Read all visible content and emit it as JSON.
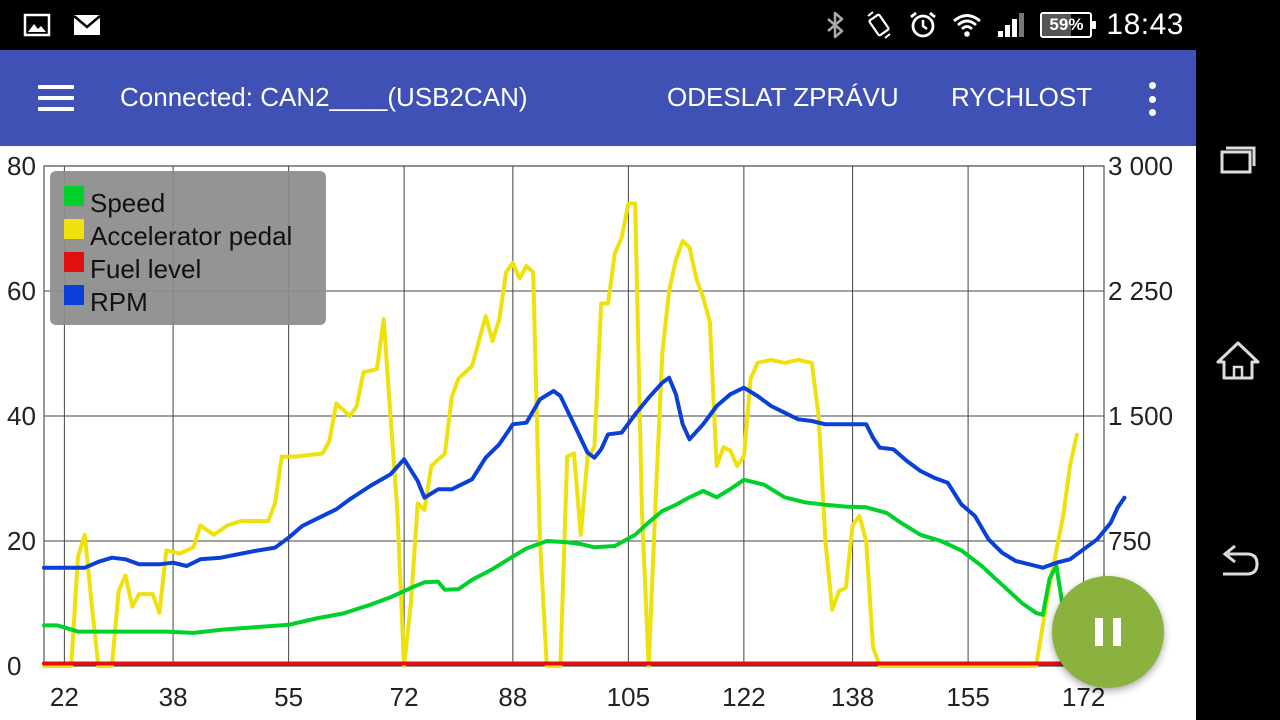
{
  "status_bar": {
    "time": "18:43",
    "battery_percent": 59,
    "battery_label": "59%",
    "icons_left": [
      "image-icon",
      "mail-icon"
    ],
    "icons_right": [
      "bluetooth-icon",
      "vibrate-icon",
      "alarm-icon",
      "wifi-icon",
      "signal-icon"
    ]
  },
  "app_bar": {
    "title": "Connected: CAN2____(USB2CAN)",
    "actions": [
      "ODESLAT ZPRÁVU",
      "RYCHLOST"
    ],
    "icons": [
      "menu-icon",
      "overflow-icon"
    ]
  },
  "fab": {
    "icon": "pause-icon"
  },
  "nav_bar": {
    "icons": [
      "recents-icon",
      "home-icon",
      "back-icon"
    ]
  },
  "colors": {
    "app_bar": "#3F51B5",
    "fab": "#8BB23F",
    "speed": "#00D02A",
    "accelerator": "#EEE10C",
    "fuel": "#E01010",
    "rpm": "#0A40D8",
    "legend_bg": "#8C8C8C"
  },
  "chart_data": {
    "type": "line",
    "grid": true,
    "legend_position": "top-left",
    "x_range": [
      19,
      175
    ],
    "x_ticks": [
      "22",
      "38",
      "55",
      "72",
      "88",
      "105",
      "122",
      "138",
      "155",
      "172"
    ],
    "y_left": {
      "range": [
        0,
        80
      ],
      "ticks": [
        "0",
        "20",
        "40",
        "60",
        "80"
      ]
    },
    "y_right": {
      "range": [
        0,
        3000
      ],
      "ticks": [
        "750",
        "1 500",
        "2 250",
        "3 000"
      ]
    },
    "series": [
      {
        "name": "Speed",
        "axis": "left",
        "color": "#00D02A",
        "points": [
          [
            19,
            6.5
          ],
          [
            21,
            6.5
          ],
          [
            24,
            5.5
          ],
          [
            28,
            5.5
          ],
          [
            32,
            5.5
          ],
          [
            37,
            5.5
          ],
          [
            41,
            5.3
          ],
          [
            45,
            5.8
          ],
          [
            50,
            6.2
          ],
          [
            55,
            6.6
          ],
          [
            59,
            7.6
          ],
          [
            63,
            8.4
          ],
          [
            67,
            9.8
          ],
          [
            70,
            11
          ],
          [
            73,
            12.5
          ],
          [
            75,
            13.4
          ],
          [
            77,
            13.5
          ],
          [
            78,
            12.2
          ],
          [
            80,
            12.3
          ],
          [
            82,
            13.8
          ],
          [
            85,
            15.5
          ],
          [
            88,
            17.5
          ],
          [
            90,
            18.8
          ],
          [
            93,
            20
          ],
          [
            96,
            19.8
          ],
          [
            98,
            19.5
          ],
          [
            100,
            19
          ],
          [
            103,
            19.2
          ],
          [
            106,
            21
          ],
          [
            108,
            23
          ],
          [
            110,
            24.8
          ],
          [
            112,
            25.8
          ],
          [
            114,
            27
          ],
          [
            116,
            28
          ],
          [
            118,
            27
          ],
          [
            120,
            28.3
          ],
          [
            122,
            29.8
          ],
          [
            125,
            29
          ],
          [
            128,
            27
          ],
          [
            131,
            26.2
          ],
          [
            134,
            25.8
          ],
          [
            137,
            25.5
          ],
          [
            140,
            25.4
          ],
          [
            143,
            24.5
          ],
          [
            145,
            23
          ],
          [
            148,
            21
          ],
          [
            151,
            20
          ],
          [
            154,
            18.5
          ],
          [
            157,
            16
          ],
          [
            160,
            13
          ],
          [
            163,
            10
          ],
          [
            165,
            8.5
          ],
          [
            166,
            8.2
          ],
          [
            167,
            14
          ],
          [
            168,
            16
          ],
          [
            169,
            9
          ],
          [
            170,
            4
          ],
          [
            172,
            2
          ],
          [
            175,
            0.5
          ]
        ]
      },
      {
        "name": "Accelerator pedal",
        "axis": "left",
        "color": "#EEE10C",
        "points": [
          [
            19,
            0
          ],
          [
            23,
            0
          ],
          [
            24,
            17.5
          ],
          [
            25,
            21
          ],
          [
            26,
            10
          ],
          [
            27,
            0
          ],
          [
            29,
            0
          ],
          [
            30,
            12
          ],
          [
            31,
            14.5
          ],
          [
            32,
            9.5
          ],
          [
            33,
            11.5
          ],
          [
            35,
            11.5
          ],
          [
            36,
            8.5
          ],
          [
            37,
            18.5
          ],
          [
            39,
            18
          ],
          [
            41,
            19
          ],
          [
            42,
            22.5
          ],
          [
            44,
            21
          ],
          [
            46,
            22.5
          ],
          [
            48,
            23.2
          ],
          [
            52,
            23.2
          ],
          [
            53,
            26
          ],
          [
            54,
            33.5
          ],
          [
            56,
            33.5
          ],
          [
            60,
            34
          ],
          [
            61,
            36
          ],
          [
            62,
            42
          ],
          [
            64,
            40
          ],
          [
            65,
            41.5
          ],
          [
            66,
            47
          ],
          [
            68,
            47.5
          ],
          [
            69,
            55.5
          ],
          [
            70,
            40
          ],
          [
            71,
            25
          ],
          [
            72,
            0
          ],
          [
            73,
            10
          ],
          [
            74,
            26
          ],
          [
            75,
            25
          ],
          [
            76,
            32
          ],
          [
            78,
            34
          ],
          [
            79,
            43
          ],
          [
            80,
            46
          ],
          [
            82,
            48
          ],
          [
            84,
            56
          ],
          [
            85,
            52
          ],
          [
            86,
            55.5
          ],
          [
            87,
            63
          ],
          [
            88,
            64.5
          ],
          [
            89,
            62
          ],
          [
            90,
            64
          ],
          [
            91,
            63
          ],
          [
            92,
            20
          ],
          [
            93,
            0
          ],
          [
            94,
            0
          ],
          [
            95,
            0
          ],
          [
            96,
            33.5
          ],
          [
            97,
            34
          ],
          [
            98,
            21
          ],
          [
            99,
            33.5
          ],
          [
            100,
            35
          ],
          [
            101,
            58
          ],
          [
            102,
            58
          ],
          [
            103,
            66
          ],
          [
            104,
            68.5
          ],
          [
            105,
            74
          ],
          [
            106,
            74
          ],
          [
            107,
            25
          ],
          [
            108,
            0
          ],
          [
            109,
            26
          ],
          [
            110,
            50
          ],
          [
            111,
            60
          ],
          [
            112,
            65
          ],
          [
            113,
            68
          ],
          [
            114,
            67
          ],
          [
            115,
            62
          ],
          [
            116,
            59
          ],
          [
            117,
            55
          ],
          [
            118,
            32
          ],
          [
            119,
            35
          ],
          [
            120,
            34.5
          ],
          [
            121,
            32
          ],
          [
            122,
            33.5
          ],
          [
            123,
            46
          ],
          [
            124,
            48.5
          ],
          [
            126,
            49
          ],
          [
            128,
            48.5
          ],
          [
            130,
            49
          ],
          [
            132,
            48.5
          ],
          [
            133,
            40
          ],
          [
            134,
            20
          ],
          [
            135,
            9
          ],
          [
            136,
            12
          ],
          [
            137,
            12.5
          ],
          [
            138,
            22.5
          ],
          [
            139,
            24
          ],
          [
            140,
            20
          ],
          [
            141,
            3
          ],
          [
            142,
            0
          ],
          [
            165,
            0
          ],
          [
            167,
            13
          ],
          [
            168,
            18.5
          ],
          [
            169,
            24
          ],
          [
            170,
            32
          ],
          [
            171,
            37
          ]
        ]
      },
      {
        "name": "Fuel level",
        "axis": "left",
        "color": "#E01010",
        "points": [
          [
            19,
            0.4
          ],
          [
            171,
            0.4
          ]
        ]
      },
      {
        "name": "RPM",
        "axis": "right",
        "color": "#0A40D8",
        "points": [
          [
            19,
            590
          ],
          [
            25,
            590
          ],
          [
            27,
            625
          ],
          [
            29,
            650
          ],
          [
            31,
            640
          ],
          [
            33,
            610
          ],
          [
            36,
            610
          ],
          [
            38,
            620
          ],
          [
            40,
            600
          ],
          [
            42,
            640
          ],
          [
            45,
            650
          ],
          [
            50,
            690
          ],
          [
            53,
            710
          ],
          [
            55,
            770
          ],
          [
            57,
            840
          ],
          [
            59,
            880
          ],
          [
            62,
            940
          ],
          [
            64,
            1000
          ],
          [
            67,
            1080
          ],
          [
            70,
            1150
          ],
          [
            72,
            1240
          ],
          [
            74,
            1110
          ],
          [
            75,
            1010
          ],
          [
            77,
            1060
          ],
          [
            79,
            1060
          ],
          [
            82,
            1120
          ],
          [
            84,
            1250
          ],
          [
            86,
            1330
          ],
          [
            88,
            1450
          ],
          [
            90,
            1460
          ],
          [
            92,
            1600
          ],
          [
            94,
            1650
          ],
          [
            95,
            1620
          ],
          [
            97,
            1450
          ],
          [
            99,
            1280
          ],
          [
            100,
            1250
          ],
          [
            101,
            1300
          ],
          [
            102,
            1390
          ],
          [
            104,
            1400
          ],
          [
            106,
            1510
          ],
          [
            108,
            1610
          ],
          [
            110,
            1700
          ],
          [
            111,
            1730
          ],
          [
            112,
            1630
          ],
          [
            113,
            1450
          ],
          [
            114,
            1360
          ],
          [
            116,
            1450
          ],
          [
            118,
            1560
          ],
          [
            120,
            1630
          ],
          [
            122,
            1670
          ],
          [
            124,
            1620
          ],
          [
            126,
            1560
          ],
          [
            128,
            1520
          ],
          [
            130,
            1480
          ],
          [
            132,
            1470
          ],
          [
            134,
            1450
          ],
          [
            136,
            1450
          ],
          [
            138,
            1450
          ],
          [
            140,
            1450
          ],
          [
            141,
            1370
          ],
          [
            142,
            1310
          ],
          [
            144,
            1300
          ],
          [
            146,
            1230
          ],
          [
            148,
            1170
          ],
          [
            150,
            1130
          ],
          [
            152,
            1100
          ],
          [
            154,
            970
          ],
          [
            156,
            900
          ],
          [
            158,
            760
          ],
          [
            160,
            680
          ],
          [
            162,
            630
          ],
          [
            164,
            610
          ],
          [
            166,
            590
          ],
          [
            168,
            620
          ],
          [
            170,
            640
          ],
          [
            172,
            700
          ],
          [
            174,
            760
          ],
          [
            176,
            860
          ],
          [
            177,
            950
          ],
          [
            178,
            1010
          ]
        ]
      }
    ]
  }
}
